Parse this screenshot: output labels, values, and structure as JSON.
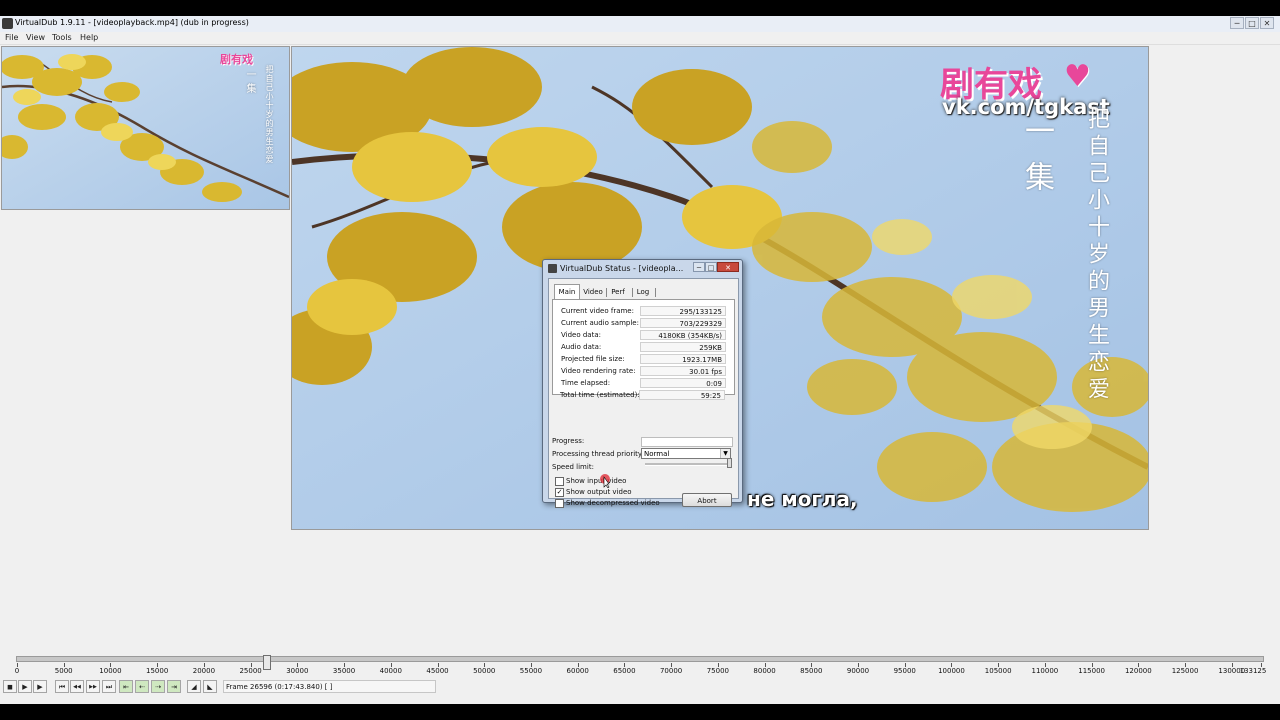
{
  "window": {
    "title": "VirtualDub 1.9.11 - [videoplayback.mp4] (dub in progress)",
    "controls": [
      "─",
      "□",
      "✕"
    ]
  },
  "menu": [
    "File",
    "View",
    "Tools",
    "Help"
  ],
  "input_pane": {
    "watermark_cn": "剧有戏",
    "vertical_left": "一集",
    "vertical_right": "把自己小十岁的男生恋爱"
  },
  "output_pane": {
    "watermark_cn": "剧有戏",
    "watermark_vk": "vk.com/tgkast",
    "vertical_left": "一集",
    "vertical_right": "把自己小十岁的男生恋爱",
    "subtitle": "не могла,"
  },
  "status_dialog": {
    "title": "VirtualDub Status - [videopla...",
    "controls": [
      "─",
      "□",
      "✕"
    ],
    "tabs": [
      "Main",
      "Video",
      "Perf",
      "Log"
    ],
    "active_tab": "Main",
    "rows": [
      {
        "label": "Current video frame:",
        "value": "295/133125"
      },
      {
        "label": "Current audio sample:",
        "value": "703/229329"
      },
      {
        "label": "Video data:",
        "value": "4180KB (354KB/s)"
      },
      {
        "label": "Audio data:",
        "value": "259KB"
      },
      {
        "label": "Projected file size:",
        "value": "1923.17MB"
      },
      {
        "label": "Video rendering rate:",
        "value": "30.01 fps"
      },
      {
        "label": "Time elapsed:",
        "value": "0:09"
      },
      {
        "label": "Total time (estimated):",
        "value": "59:25"
      }
    ],
    "progress_label": "Progress:",
    "priority_label": "Processing thread priority:",
    "priority_value": "Normal",
    "speed_label": "Speed limit:",
    "checkboxes": [
      {
        "label": "Show input video",
        "checked": false
      },
      {
        "label": "Show output video",
        "checked": true
      },
      {
        "label": "Show decompressed video",
        "checked": false
      }
    ],
    "abort_label": "Abort"
  },
  "timeline": {
    "ticks": [
      "0",
      "5000",
      "10000",
      "15000",
      "20000",
      "25000",
      "30000",
      "35000",
      "40000",
      "45000",
      "50000",
      "55000",
      "60000",
      "65000",
      "70000",
      "75000",
      "80000",
      "85000",
      "90000",
      "95000",
      "100000",
      "105000",
      "110000",
      "115000",
      "120000",
      "125000",
      "130000",
      "133125"
    ],
    "position_frame": 26596,
    "total_frames": 133125
  },
  "toolbar": {
    "buttons": [
      {
        "name": "stop-icon",
        "glyph": "◼"
      },
      {
        "name": "play-input-icon",
        "glyph": "▶"
      },
      {
        "name": "play-output-icon",
        "glyph": "▶"
      },
      {
        "name": "start-icon",
        "glyph": "⏮"
      },
      {
        "name": "prev-key-icon",
        "glyph": "◀◀"
      },
      {
        "name": "next-key-icon",
        "glyph": "▶▶"
      },
      {
        "name": "end-icon",
        "glyph": "⏭"
      },
      {
        "name": "scene-back-icon",
        "glyph": "⇤"
      },
      {
        "name": "scene-prev-icon",
        "glyph": "⇠"
      },
      {
        "name": "scene-next-icon",
        "glyph": "⇢"
      },
      {
        "name": "scene-fwd-icon",
        "glyph": "⇥"
      },
      {
        "name": "mark-in-icon",
        "glyph": "◢"
      },
      {
        "name": "mark-out-icon",
        "glyph": "◣"
      }
    ],
    "frame_text": "Frame 26596 (0:17:43.840) [ ]"
  }
}
